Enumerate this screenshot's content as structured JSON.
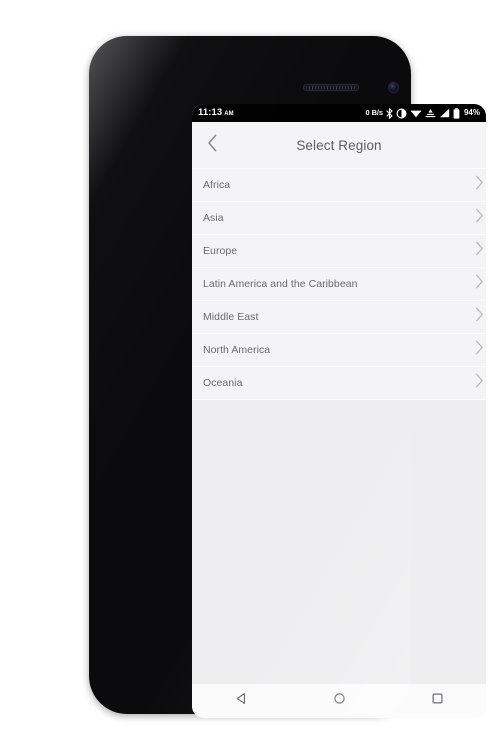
{
  "device": {
    "earpiece_icon": "earpiece-speaker",
    "camera_icon": "front-camera"
  },
  "status_bar": {
    "time": "11:13",
    "am_pm": "AM",
    "network_speed": "0 B/s",
    "bluetooth_icon": "bluetooth-icon",
    "dnd_icon": "do-not-disturb-icon",
    "wifi_icon": "wifi-icon",
    "vpn_icon": "vpn-icon",
    "signal_icon": "signal-bars-icon",
    "battery_icon": "battery-icon",
    "battery_percent": "94%"
  },
  "header": {
    "back_icon": "chevron-left-icon",
    "title": "Select Region"
  },
  "list": {
    "chevron_icon": "chevron-right-icon",
    "items": [
      {
        "label": "Africa"
      },
      {
        "label": "Asia"
      },
      {
        "label": "Europe"
      },
      {
        "label": "Latin America and the Caribbean"
      },
      {
        "label": "Middle East"
      },
      {
        "label": "North America"
      },
      {
        "label": "Oceania"
      }
    ]
  },
  "nav_bar": {
    "back_icon": "nav-back-triangle-icon",
    "home_icon": "nav-home-circle-icon",
    "recents_icon": "nav-recents-square-icon"
  },
  "colors": {
    "screen_bg": "#eeeef0",
    "panel_bg": "#f4f4f6",
    "text": "#6a6a70",
    "title_text": "#5d5d63",
    "status_bg": "#000000",
    "nav_bg": "#fbfbfb"
  }
}
